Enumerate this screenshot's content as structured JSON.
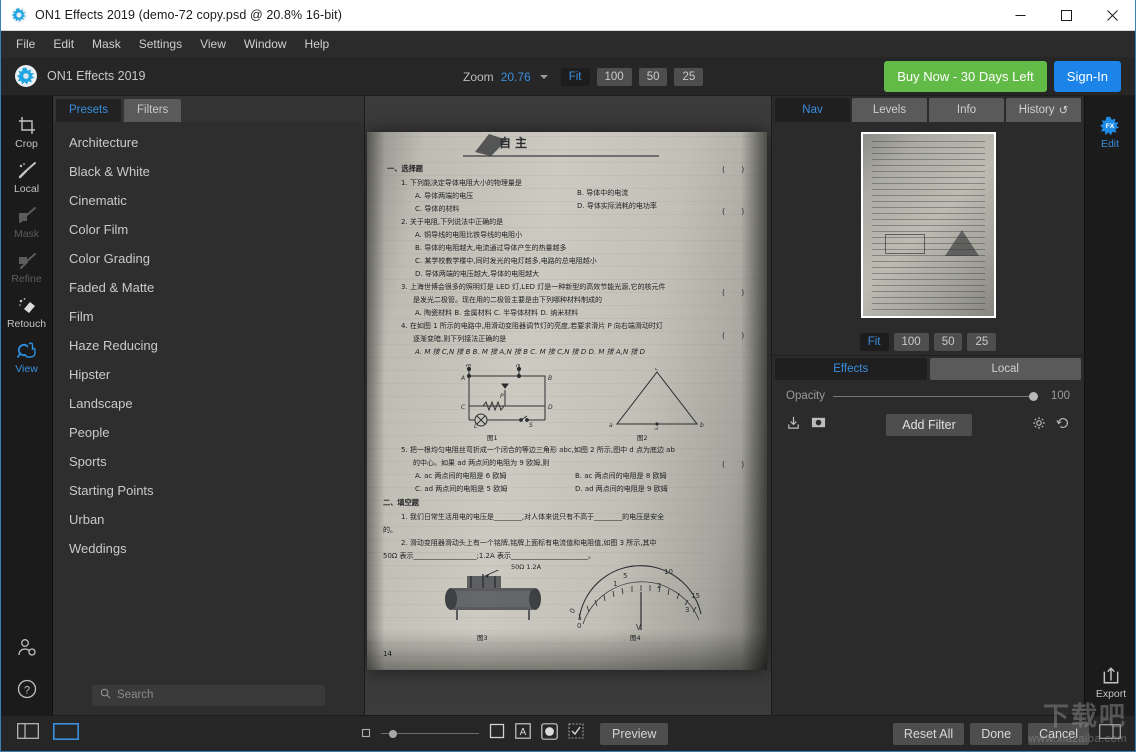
{
  "window": {
    "title": "ON1 Effects 2019 (demo-72 copy.psd @ 20.8% 16-bit)",
    "minimize": "—",
    "maximize": "□",
    "close": "✕"
  },
  "menubar": {
    "items": [
      "File",
      "Edit",
      "Mask",
      "Settings",
      "View",
      "Window",
      "Help"
    ]
  },
  "toolbar": {
    "brand_name": "ON1 Effects 2019",
    "zoom_label": "Zoom",
    "zoom_value": "20.76",
    "zoom_presets": [
      "Fit",
      "100",
      "50",
      "25"
    ],
    "zoom_active": "Fit",
    "buy_now": "Buy Now - 30 Days Left",
    "sign_in": "Sign-In"
  },
  "tool_rail": {
    "tools": [
      {
        "label": "Crop",
        "state": "normal"
      },
      {
        "label": "Local",
        "state": "normal"
      },
      {
        "label": "Mask",
        "state": "disabled"
      },
      {
        "label": "Refine",
        "state": "disabled"
      },
      {
        "label": "Retouch",
        "state": "normal"
      },
      {
        "label": "View",
        "state": "active"
      }
    ],
    "bottom_icons": [
      "account-icon",
      "help-icon"
    ]
  },
  "presets_panel": {
    "tabs": [
      "Presets",
      "Filters"
    ],
    "active_tab": "Presets",
    "items": [
      "Architecture",
      "Black & White",
      "Cinematic",
      "Color Film",
      "Color Grading",
      "Faded & Matte",
      "Film",
      "Haze Reducing",
      "Hipster",
      "Landscape",
      "People",
      "Sports",
      "Starting Points",
      "Urban",
      "Weddings"
    ],
    "search_placeholder": "Search",
    "search_value": ""
  },
  "right_panel": {
    "tabs": [
      "Nav",
      "Levels",
      "Info",
      "History"
    ],
    "active_tab": "Nav",
    "history_icon": "↺",
    "zoom_presets": [
      "Fit",
      "100",
      "50",
      "25"
    ],
    "zoom_active": "Fit",
    "effect_tabs": [
      "Effects",
      "Local"
    ],
    "effect_active": "Effects",
    "opacity_label": "Opacity",
    "opacity_value": "100",
    "add_filter": "Add Filter"
  },
  "right_rail": {
    "edit_label": "Edit",
    "export_label": "Export"
  },
  "status_bar": {
    "preview": "Preview",
    "reset_all": "Reset All",
    "done": "Done",
    "cancel": "Cancel"
  },
  "watermark": {
    "line1": "下载吧",
    "line2": "www.xiazaiba.com"
  },
  "canvas_photo": {
    "page_number": "14",
    "section1_title": "一、选择题",
    "q1": "1. 下列能决定导体电阻大小的物理量是",
    "q1a": "A. 导体两端的电压",
    "q1b": "B. 导体中的电流",
    "q1c": "C. 导体的材料",
    "q1d": "D. 导体实际消耗的电功率",
    "q2": "2. 关于电阻,下列说法中正确的是",
    "q2a": "A. 铜导线的电阻比铁导线的电阻小",
    "q2b": "B. 导体的电阻越大,电流通过导体产生的热量越多",
    "q2c": "C. 某学校教学楼中,同时发光的电灯越多,电路的总电阻越小",
    "q2d": "D. 导体两端的电压越大,导体的电阻越大",
    "q3l1": "3. 上海世博会很多的照明灯是 LED 灯,LED 灯是一种新型的高效节能光源,它的核元件",
    "q3l2": "是发光二极管。现在用的二极管主要是由下列哪种材料制成的",
    "q3opts": "A. 陶瓷材料          B. 金属材料          C. 半导体材料          D. 纳米材料",
    "q4l1": "4. 在如图 1 所示的电路中,用滑动变阻器调节灯的亮度,若要求滑片 P 向右端滑动时灯",
    "q4l2": "逐渐变暗,则下列接法正确的是",
    "q4opts": "A. M 接 C,N 接 B     B. M 接 A,N 接 B     C. M 接 C,N 接 D     D. M 接 A,N 接 D",
    "fig1": "图1",
    "fig2": "图2",
    "fig3": "图3",
    "fig4": "图4",
    "q5l1": "5. 把一根均匀电阻丝弯折成一个闭合的等边三角形 abc,如图 2 所示,图中 d 点为底边 ab",
    "q5l2": "的中心。如果 ad 两点间的电阻为 9 欧姆,则",
    "q5a": "A. ac 两点间的电阻是 6 欧姆",
    "q5b": "B. ac 两点间的电阻是 8 欧姆",
    "q5c": "C. ad 两点间的电阻是 5 欧姆",
    "q5d": "D. ad 两点间的电阻是 9 欧姆",
    "section2_title": "二、填空题",
    "f1l1": "1. 我们日常生活用电的电压是________,对人体来说只有不高于________的电压是安全",
    "f1l2": "的。",
    "f2l1": "2. 滑动变阻器滑动头上有一个铭牌,铭牌上面标有电流值和电阻值,如图 3 所示,其中",
    "f2l2": "50Ω 表示__________________;1.2A 表示______________________。",
    "label_50ohm": "50Ω 1.2A",
    "meter_marks": [
      "0",
      "0",
      "1",
      "2",
      "3",
      "5",
      "10",
      "15",
      "V"
    ],
    "bracket_marks": [
      "(",
      ")"
    ]
  }
}
